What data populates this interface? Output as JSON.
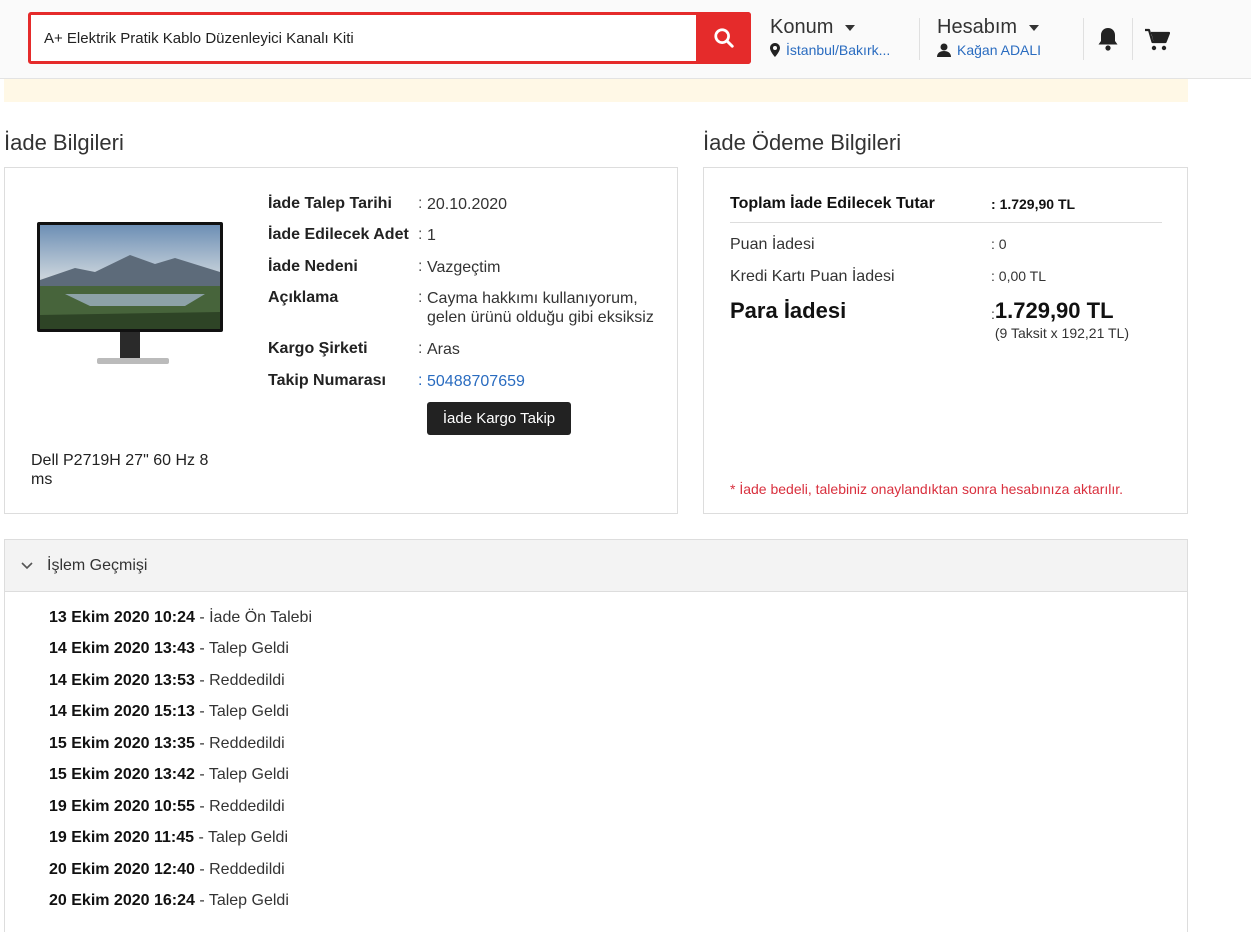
{
  "header": {
    "search_value": "A+ Elektrik Pratik Kablo Düzenleyici Kanalı Kiti",
    "location_title": "Konum",
    "location_value": "İstanbul/Bakırk...",
    "account_title": "Hesabım",
    "account_user": "Kağan ADALI",
    "icons": [
      "search-icon",
      "map-pin-icon",
      "user-icon",
      "bell-icon",
      "cart-icon"
    ],
    "accent_color": "#e52b2b"
  },
  "return_info": {
    "title": "İade Bilgileri",
    "product_name": "Dell P2719H 27\" 60 Hz 8 ms",
    "rows": [
      {
        "label": "İade Talep Tarihi",
        "value": "20.10.2020"
      },
      {
        "label": "İade Edilecek Adet",
        "value": "1"
      },
      {
        "label": "İade Nedeni",
        "value": "Vazgeçtim"
      },
      {
        "label": "Açıklama",
        "value": "Cayma hakkımı kullanıyorum, gelen ürünü olduğu gibi eksiksiz"
      },
      {
        "label": "Kargo Şirketi",
        "value": "Aras"
      },
      {
        "label": "Takip Numarası",
        "value": "50488707659"
      }
    ],
    "track_button": "İade Kargo Takip"
  },
  "payment_info": {
    "title": "İade Ödeme Bilgileri",
    "total_label": "Toplam İade Edilecek Tutar",
    "total_value": "1.729,90 TL",
    "points_label": "Puan İadesi",
    "points_value": "0",
    "cc_points_label": "Kredi Kartı Puan İadesi",
    "cc_points_value": "0,00 TL",
    "refund_label": "Para İadesi",
    "refund_value": "1.729,90 TL",
    "refund_installment": "(9 Taksit x 192,21 TL)",
    "note": "* İade bedeli, talebiniz onaylandıktan sonra hesabınıza aktarılır."
  },
  "history": {
    "title": "İşlem Geçmişi",
    "items": [
      {
        "date": "13 Ekim 2020 10:24",
        "status": "İade Ön Talebi"
      },
      {
        "date": "14 Ekim 2020 13:43",
        "status": "Talep Geldi"
      },
      {
        "date": "14 Ekim 2020 13:53",
        "status": "Reddedildi"
      },
      {
        "date": "14 Ekim 2020 15:13",
        "status": "Talep Geldi"
      },
      {
        "date": "15 Ekim 2020 13:35",
        "status": "Reddedildi"
      },
      {
        "date": "15 Ekim 2020 13:42",
        "status": "Talep Geldi"
      },
      {
        "date": "19 Ekim 2020 10:55",
        "status": "Reddedildi"
      },
      {
        "date": "19 Ekim 2020 11:45",
        "status": "Talep Geldi"
      },
      {
        "date": "20 Ekim 2020 12:40",
        "status": "Reddedildi"
      },
      {
        "date": "20 Ekim 2020 16:24",
        "status": "Talep Geldi"
      }
    ]
  }
}
